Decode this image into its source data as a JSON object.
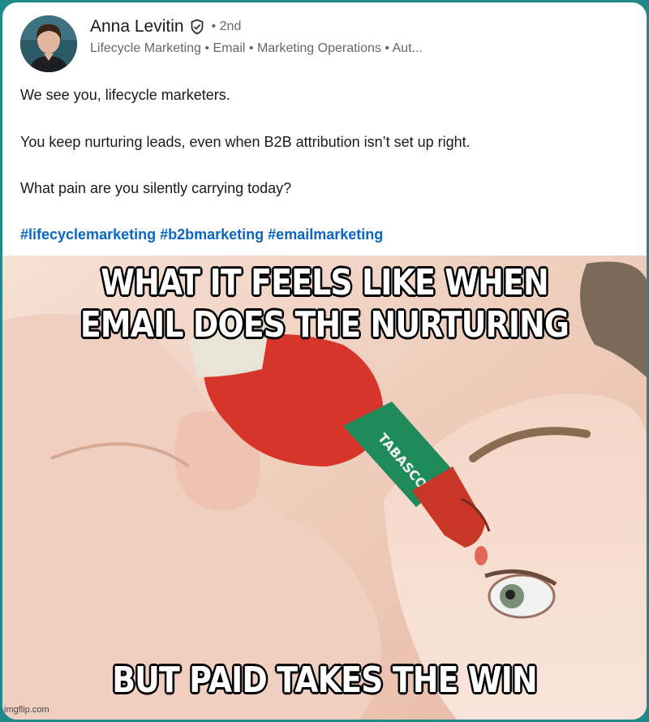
{
  "author": {
    "name": "Anna Levitin",
    "degree": "2nd",
    "headline": "Lifecycle Marketing • Email • Marketing Operations • Aut..."
  },
  "post": {
    "paragraphs": [
      "We see you, lifecycle marketers.",
      "You keep nurturing leads, even when B2B attribution isn’t set up right.",
      "What pain are you silently carrying today?"
    ],
    "hashtags": [
      "#lifecyclemarketing",
      "#b2bmarketing",
      "#emailmarketing"
    ]
  },
  "meme": {
    "top_line1": "WHAT IT FEELS LIKE WHEN",
    "top_line2": "EMAIL DOES THE NURTURING",
    "bottom_line": "BUT PAID TAKES THE WIN",
    "bottle_label": "TABASCO",
    "watermark": "imgflip.com"
  },
  "colors": {
    "frame": "#1f8a8a",
    "link": "#0a66c2",
    "bottle_red": "#d8352a",
    "bottle_green": "#1f8a5a"
  }
}
